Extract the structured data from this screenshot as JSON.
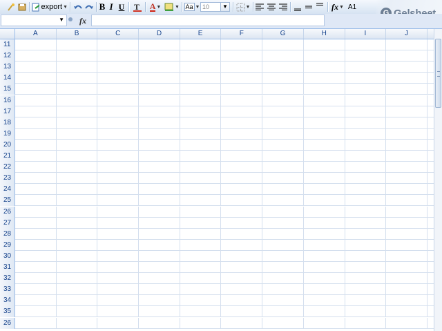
{
  "toolbar": {
    "export_label": "export",
    "font_size": "10",
    "cell_ref": "A1",
    "bold": "B",
    "italic": "I",
    "underline": "U",
    "font_color": "A",
    "fx": "fx",
    "aa": "Aa"
  },
  "logo": {
    "text": "Gelsheet",
    "mark": "G"
  },
  "formula_bar": {
    "fx": "fx",
    "name_value": "",
    "formula_value": ""
  },
  "columns": [
    "A",
    "B",
    "C",
    "D",
    "E",
    "F",
    "G",
    "H",
    "I",
    "J"
  ],
  "rows": [
    "11",
    "12",
    "13",
    "14",
    "15",
    "16",
    "17",
    "18",
    "19",
    "20",
    "21",
    "22",
    "23",
    "24",
    "25",
    "26",
    "27",
    "28",
    "29",
    "30",
    "31",
    "32",
    "33",
    "34",
    "35",
    "26"
  ],
  "colors": {
    "header_text": "#15428b",
    "grid_line": "#d4dfee",
    "border": "#99bbe8"
  }
}
